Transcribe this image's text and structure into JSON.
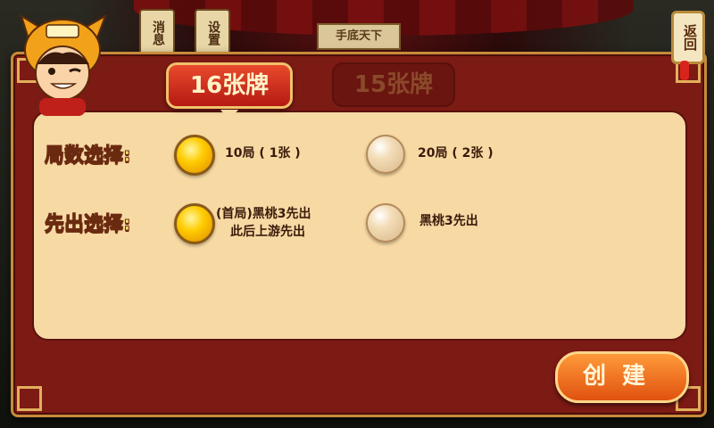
{
  "background": {
    "tab_messages": "消息",
    "tab_settings": "设置",
    "sign_text": "手底天下"
  },
  "back_button": {
    "label": "返回"
  },
  "tabs": [
    {
      "label": "16张牌",
      "active": true
    },
    {
      "label": "15张牌",
      "active": false
    }
  ],
  "rounds": {
    "label": "局数选择:",
    "options": [
      {
        "text": "10局 ( 1张 )",
        "selected": true
      },
      {
        "text": "20局 ( 2张 )",
        "selected": false
      }
    ]
  },
  "first_play": {
    "label": "先出选择:",
    "options": [
      {
        "line1": "(首局)黑桃3先出",
        "line2": "此后上游先出",
        "selected": true
      },
      {
        "line1": "黑桃3先出",
        "selected": false
      }
    ]
  },
  "create_button": {
    "label": "创建"
  },
  "colors": {
    "panel": "#7c1a14",
    "content": "#f7d9a4",
    "active_tab": "#e94a2c",
    "label_yellow": "#ffe06a",
    "button_orange": "#e0520f"
  }
}
